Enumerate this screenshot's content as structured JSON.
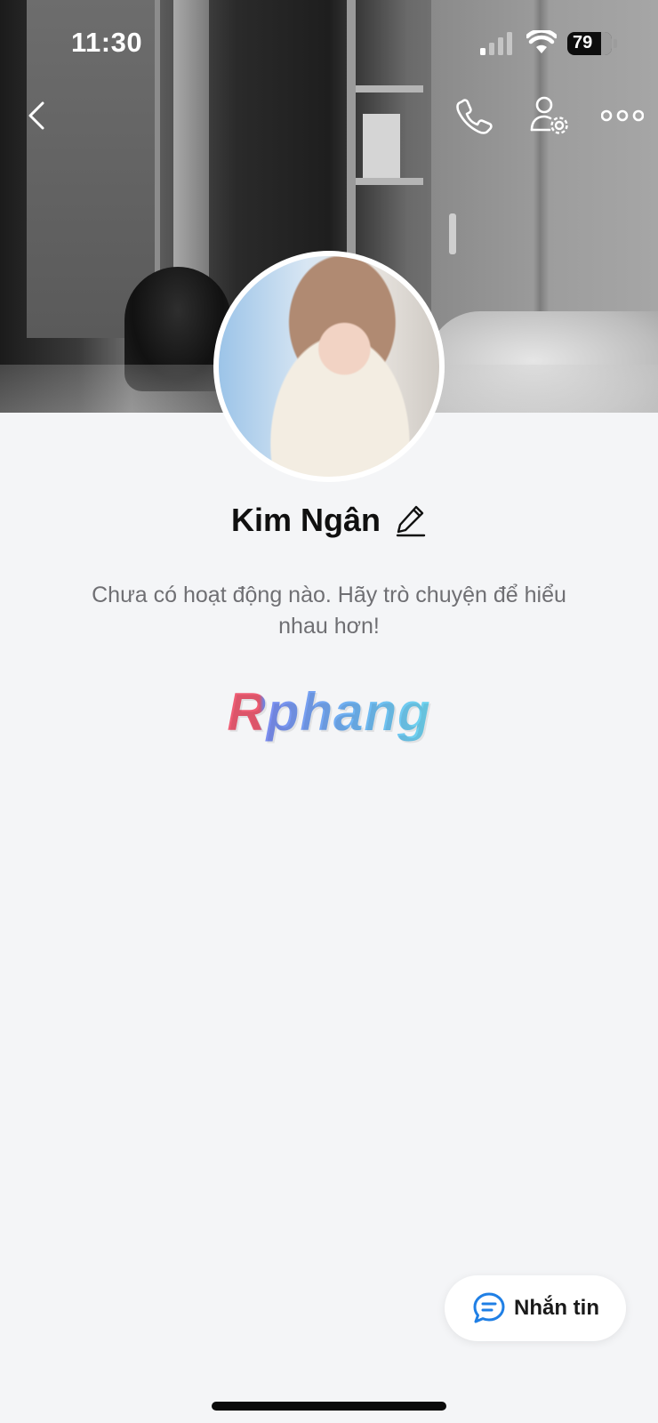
{
  "status_bar": {
    "time": "11:30",
    "battery_level": "79",
    "signal_icon": "cellular-signal-icon",
    "wifi_icon": "wifi-icon"
  },
  "header": {
    "back_icon": "chevron-left-icon",
    "call_icon": "phone-icon",
    "settings_icon": "user-settings-icon",
    "more_icon": "more-horizontal-icon"
  },
  "profile": {
    "name": "Kim Ngân",
    "edit_icon": "pencil-icon",
    "bio": "Chưa có hoạt động nào. Hãy trò chuyện để hiểu nhau hơn!"
  },
  "watermark": {
    "text": "Rphang"
  },
  "message_button": {
    "label": "Nhắn tin",
    "icon": "chat-bubble-icon"
  },
  "colors": {
    "background": "#f4f5f7",
    "accent": "#1f7fe5",
    "text_primary": "#101010",
    "text_secondary": "#6f6f73"
  }
}
